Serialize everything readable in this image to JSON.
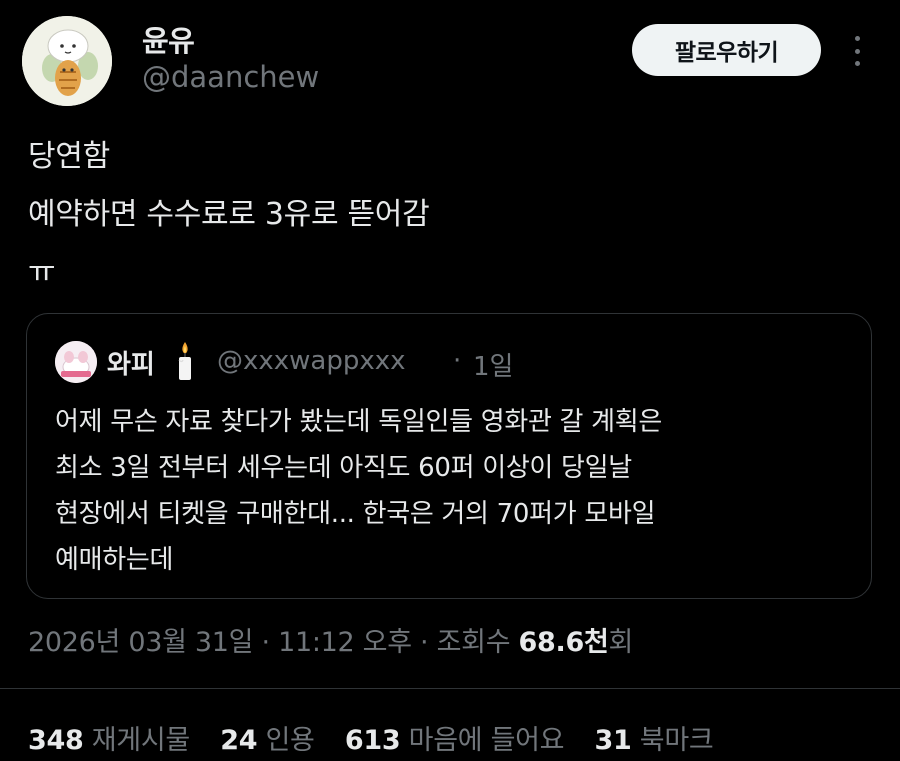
{
  "author": {
    "display_name": "윤유",
    "handle": "@daanchew",
    "avatar_icon": "cartoon-character-avatar"
  },
  "actions": {
    "follow_label": "팔로우하기",
    "more_icon": "more-dots-icon"
  },
  "tweet": {
    "lines": [
      "당연함",
      "예약하면 수수료로 3유로 뜯어감",
      "ㅠ"
    ]
  },
  "quote": {
    "display_name": "와피",
    "emoji": "candle-icon",
    "handle": "@xxxwappxxx",
    "separator": "·",
    "time": "1일",
    "lines": [
      "어제 무슨 자료 찾다가 봤는데 독일인들 영화관 갈 계획은",
      "최소 3일 전부터 세우는데 아직도 60퍼 이상이 당일날",
      "현장에서 티켓을 구매한대... 한국은 거의 70퍼가 모바일",
      "예매하는데"
    ]
  },
  "meta": {
    "date": "2026년 03월 31일",
    "separator1": " · ",
    "time": "11:12 오후",
    "separator2": " · ",
    "views_label": "조회수 ",
    "views_count": "68.6천",
    "views_suffix": "회"
  },
  "stats": {
    "reposts_count": "348",
    "reposts_label": "재게시물",
    "quotes_count": "24",
    "quotes_label": "인용",
    "likes_count": "613",
    "likes_label": "마음에 들어요",
    "bookmarks_count": "31",
    "bookmarks_label": "북마크"
  },
  "colors": {
    "background": "#000000",
    "text_primary": "#e7e9ea",
    "text_secondary": "#71767b",
    "border": "#2f3336",
    "button_bg": "#eff3f4"
  }
}
